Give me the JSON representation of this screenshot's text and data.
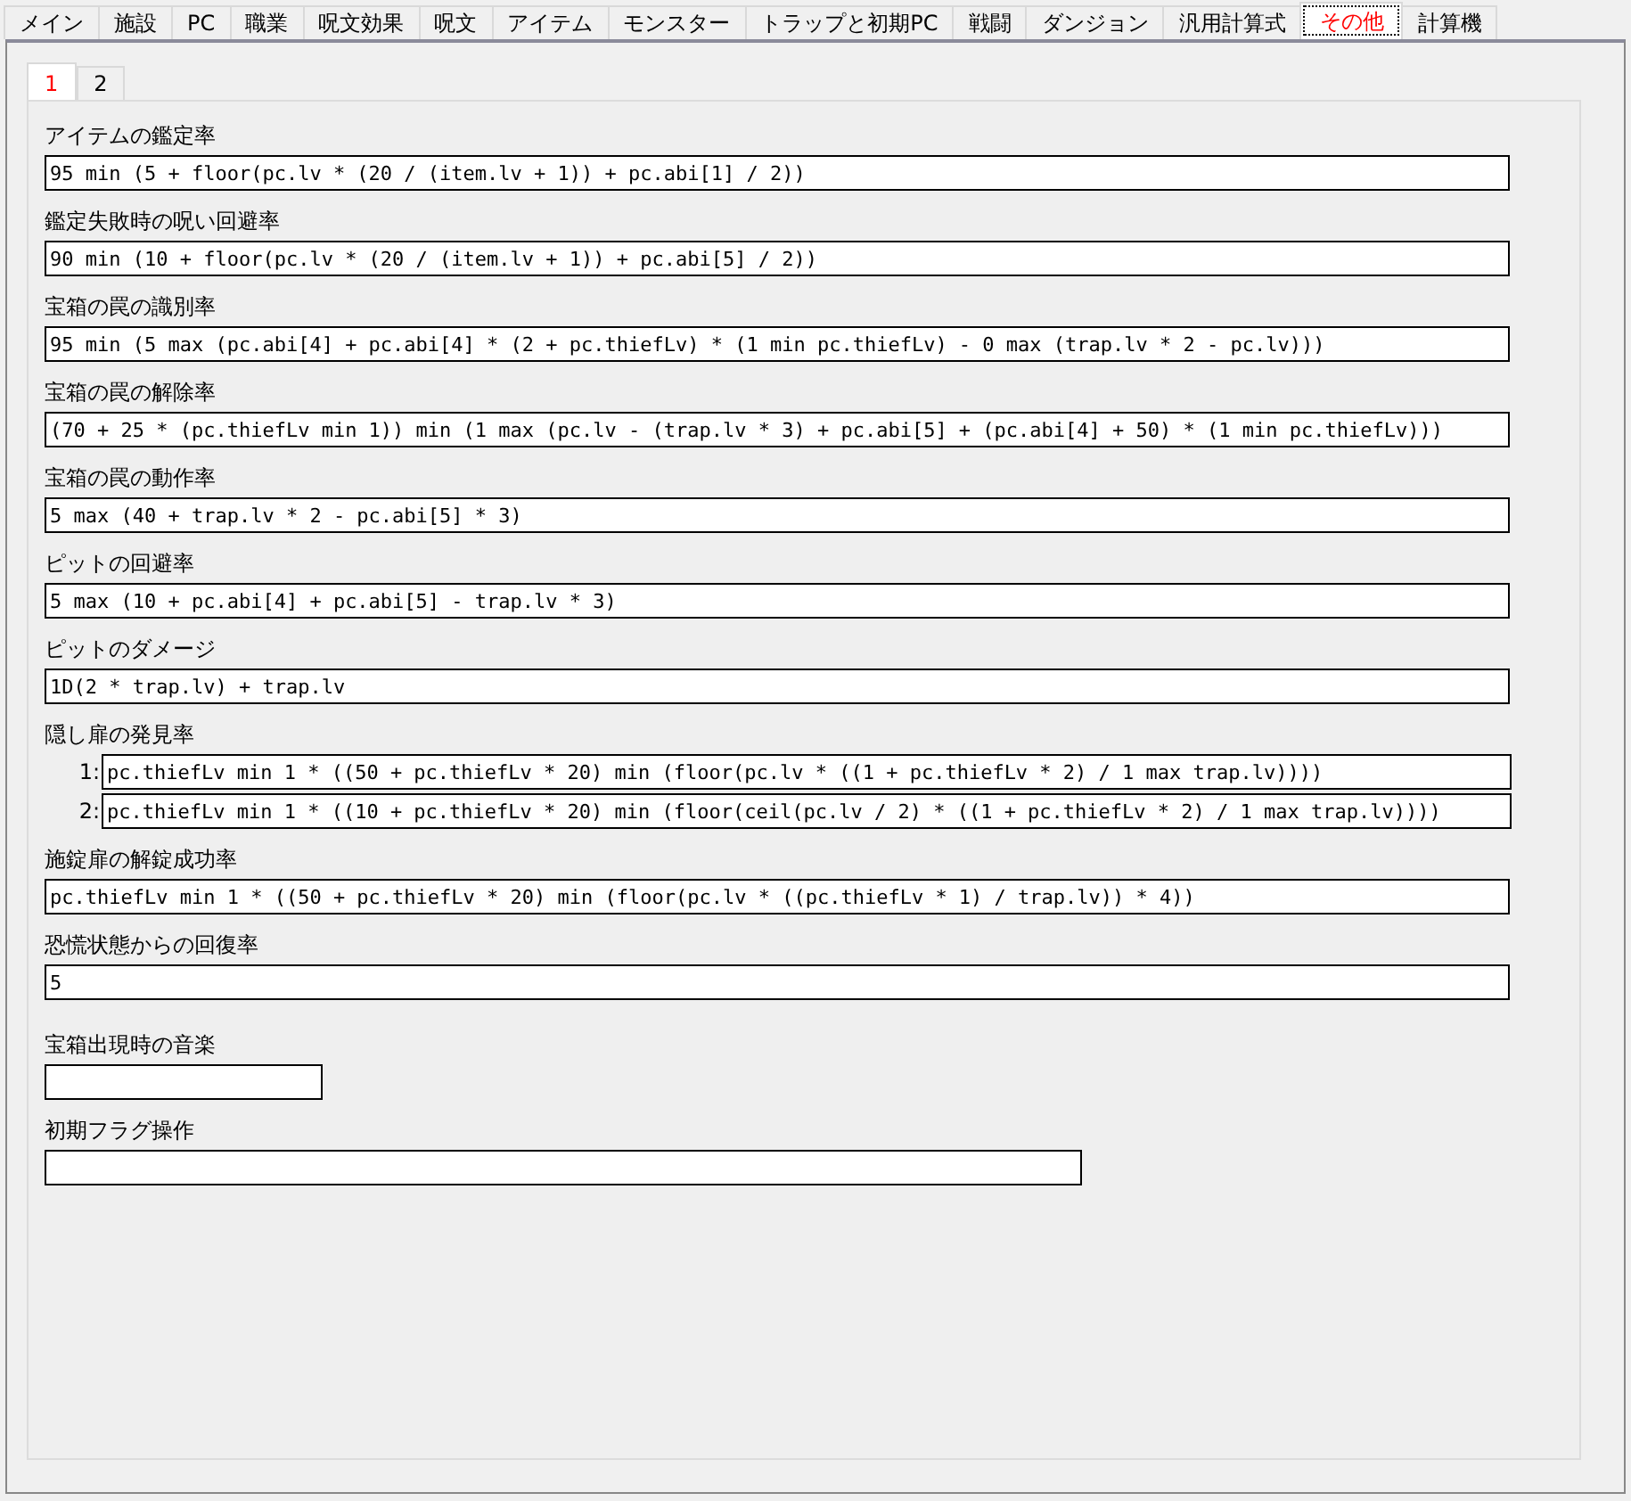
{
  "tabs": [
    {
      "label": "メイン",
      "selected": false
    },
    {
      "label": "施設",
      "selected": false
    },
    {
      "label": "PC",
      "selected": false
    },
    {
      "label": "職業",
      "selected": false
    },
    {
      "label": "呪文効果",
      "selected": false
    },
    {
      "label": "呪文",
      "selected": false
    },
    {
      "label": "アイテム",
      "selected": false
    },
    {
      "label": "モンスター",
      "selected": false
    },
    {
      "label": "トラップと初期PC",
      "selected": false
    },
    {
      "label": "戦闘",
      "selected": false
    },
    {
      "label": "ダンジョン",
      "selected": false
    },
    {
      "label": "汎用計算式",
      "selected": false
    },
    {
      "label": "その他",
      "selected": true
    },
    {
      "label": "計算機",
      "selected": false
    }
  ],
  "subtabs": [
    {
      "label": "1",
      "selected": true
    },
    {
      "label": "2",
      "selected": false
    }
  ],
  "fields": [
    {
      "label": "アイテムの鑑定率",
      "kind": "wide",
      "value": "95 min (5 + floor(pc.lv * (20 / (item.lv + 1)) + pc.abi[1] / 2))"
    },
    {
      "label": "鑑定失敗時の呪い回避率",
      "kind": "wide",
      "value": "90 min (10 + floor(pc.lv * (20 / (item.lv + 1)) + pc.abi[5] / 2))"
    },
    {
      "label": "宝箱の罠の識別率",
      "kind": "wide",
      "value": "95 min (5 max (pc.abi[4] + pc.abi[4] * (2 + pc.thiefLv) * (1 min pc.thiefLv) - 0 max (trap.lv * 2 - pc.lv)))"
    },
    {
      "label": "宝箱の罠の解除率",
      "kind": "wide",
      "value": "(70 + 25 * (pc.thiefLv min 1)) min (1 max (pc.lv - (trap.lv * 3) + pc.abi[5] + (pc.abi[4] + 50) * (1 min pc.thiefLv)))"
    },
    {
      "label": "宝箱の罠の動作率",
      "kind": "wide",
      "value": "5 max (40 + trap.lv * 2 - pc.abi[5] * 3)"
    },
    {
      "label": "ピットの回避率",
      "kind": "wide",
      "value": "5 max (10 + pc.abi[4] + pc.abi[5] - trap.lv * 3)"
    },
    {
      "label": "ピットのダメージ",
      "kind": "wide",
      "value": "1D(2 * trap.lv) + trap.lv"
    },
    {
      "label": "隠し扉の発見率",
      "kind": "numbered",
      "rows": [
        {
          "number": "1:",
          "value": "pc.thiefLv min 1 * ((50 + pc.thiefLv * 20) min (floor(pc.lv * ((1 + pc.thiefLv * 2) / 1 max trap.lv))))"
        },
        {
          "number": "2:",
          "value": "pc.thiefLv min 1 * ((10 + pc.thiefLv * 20) min (floor(ceil(pc.lv / 2) * ((1 + pc.thiefLv * 2) / 1 max trap.lv))))"
        }
      ]
    },
    {
      "label": "施錠扉の解錠成功率",
      "kind": "wide",
      "value": "pc.thiefLv min 1 * ((50 + pc.thiefLv * 20) min (floor(pc.lv * ((pc.thiefLv * 1) / trap.lv)) * 4))"
    },
    {
      "label": "恐慌状態からの回復率",
      "kind": "wide",
      "value": "5"
    },
    {
      "label": "宝箱出現時の音楽",
      "kind": "short",
      "gap": true
    },
    {
      "label": "初期フラグ操作",
      "kind": "medium"
    }
  ]
}
